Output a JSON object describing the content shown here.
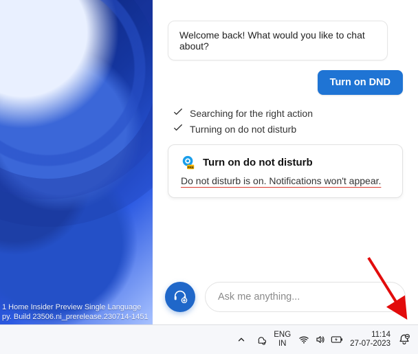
{
  "watermark": {
    "line1": "1 Home Insider Preview Single Language",
    "line2": "py. Build 23506.ni_prerelease.230714-1451"
  },
  "chat": {
    "bot_welcome": "Welcome back! What would you like to chat about?",
    "user_message": "Turn on DND",
    "status": [
      "Searching for the right action",
      "Turning on do not disturb"
    ],
    "result": {
      "title": "Turn on do not disturb",
      "description": "Do not disturb is on. Notifications won't appear."
    },
    "input_placeholder": "Ask me anything..."
  },
  "taskbar": {
    "lang1": "ENG",
    "lang2": "IN",
    "time": "11:14",
    "date": "27-07-2023"
  }
}
